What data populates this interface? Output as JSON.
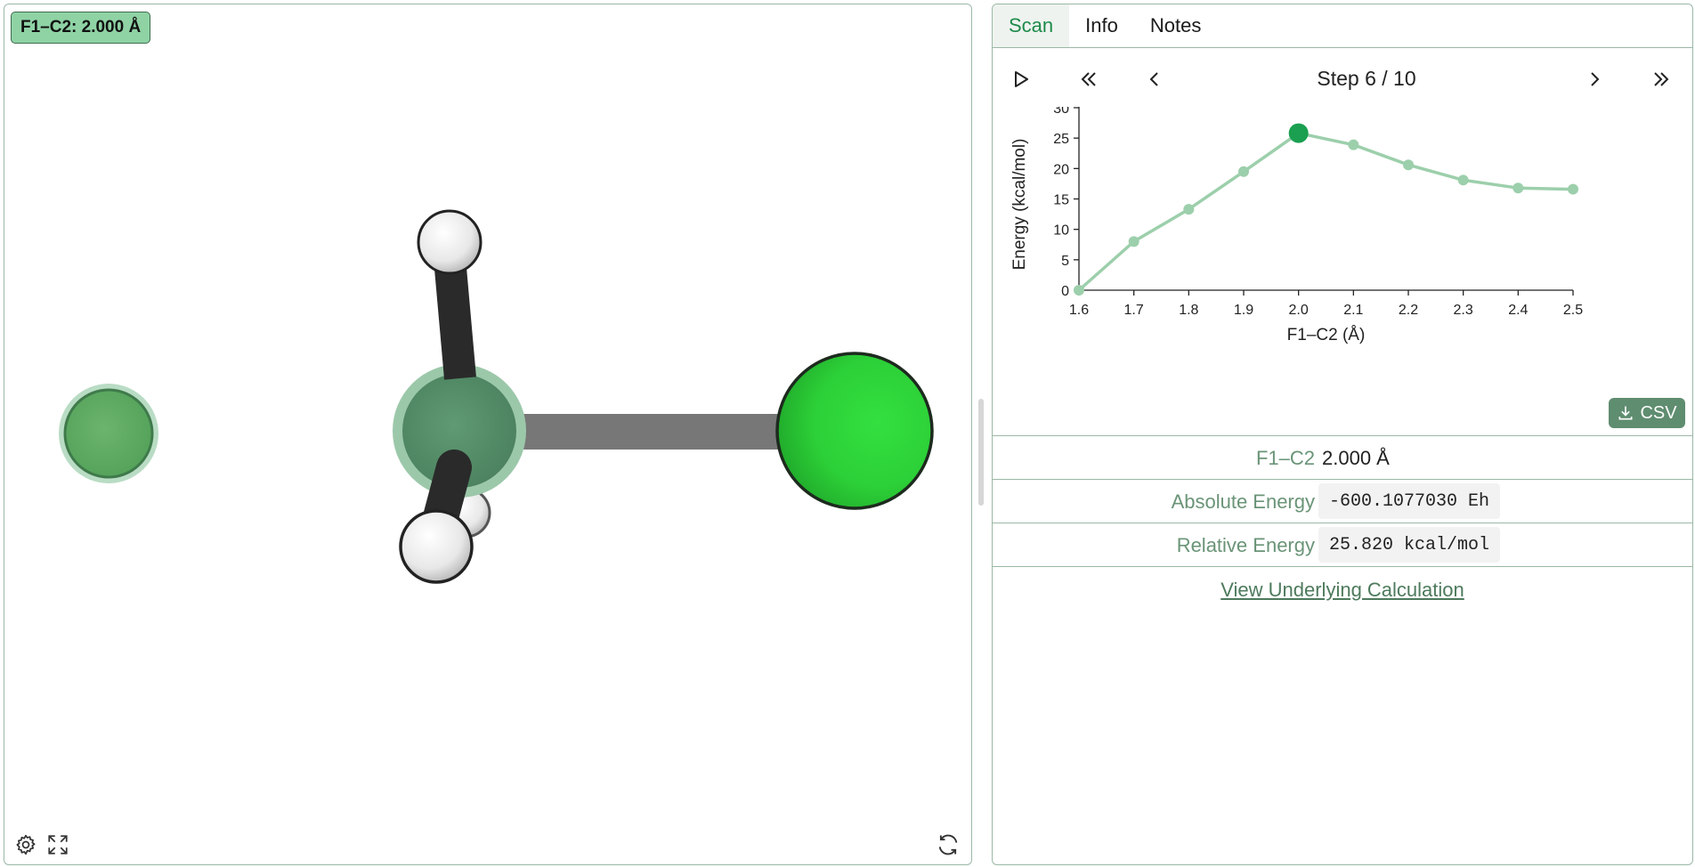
{
  "viewer": {
    "distance_badge": "F1–C2: 2.000 Å",
    "icons": [
      "gear-icon",
      "expand-icon",
      "refresh-icon"
    ]
  },
  "panel": {
    "tabs": [
      {
        "label": "Scan",
        "active": true
      },
      {
        "label": "Info",
        "active": false
      },
      {
        "label": "Notes",
        "active": false
      }
    ],
    "step_label": "Step 6 / 10",
    "nav_icons": [
      "play-icon",
      "first-step-icon",
      "previous-step-icon",
      "next-step-icon",
      "last-step-icon"
    ],
    "csv_label": "CSV",
    "rows": [
      {
        "label": "F1–C2",
        "value": "2.000 Å"
      },
      {
        "label": "Absolute Energy",
        "value": "-600.1077030 Eh"
      },
      {
        "label": "Relative Energy",
        "value": "25.820 kcal/mol"
      }
    ],
    "link_label": "View Underlying Calculation"
  },
  "colors": {
    "accent": "#1e8a4a",
    "line": "#9ccfab",
    "highlight_point": "#1aa050"
  },
  "chart_data": {
    "type": "line",
    "xlabel": "F1–C2 (Å)",
    "ylabel": "Energy (kcal/mol)",
    "x": [
      1.6,
      1.7,
      1.8,
      1.9,
      2.0,
      2.1,
      2.2,
      2.3,
      2.4,
      2.5
    ],
    "values": [
      0.0,
      8.0,
      13.3,
      19.5,
      25.82,
      23.9,
      20.6,
      18.1,
      16.8,
      16.6
    ],
    "xticks": [
      "1.6",
      "1.7",
      "1.8",
      "1.9",
      "2.0",
      "2.1",
      "2.2",
      "2.3",
      "2.4",
      "2.5"
    ],
    "yticks": [
      "0",
      "5",
      "10",
      "15",
      "20",
      "25",
      "30"
    ],
    "ylim": [
      0,
      30
    ],
    "xlim": [
      1.6,
      2.5
    ],
    "selected_index": 4,
    "grid": false
  }
}
